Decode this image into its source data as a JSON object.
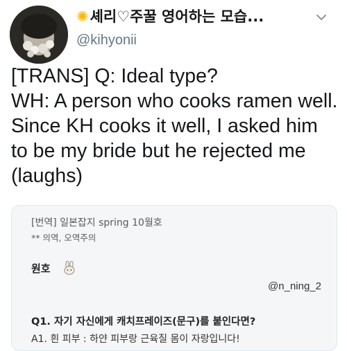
{
  "author": {
    "display_name_icon": "sun-flower-icon",
    "display_name": "셰리♡주꿀 영어하는 모습...",
    "handle": "@kihyonii",
    "avatar": "profile-photo"
  },
  "menu": {
    "icon": "chevron-down-icon"
  },
  "tweet": {
    "lines": [
      "[TRANS] Q: Ideal type?",
      "WH: A person who cooks ramen well. Since KH cooks it well, I asked him to be my bride but he rejected me (laughs)"
    ]
  },
  "quoted": {
    "header": "[번역] 일본잡지 spring 10월호",
    "note": "** 의역, 오역주의",
    "name": "원호",
    "name_icon": "bunny-icon",
    "credit": "@n_ning_2",
    "question": "Q1. 자기 자신에게 캐치프레이즈(문구)를 붙인다면?",
    "answer": "A1. 흰 피부 : 하얀 피부랑 근육질 몸이 자랑입니다!"
  },
  "colors": {
    "text": "#14171a",
    "secondary": "#657786",
    "accent_sun": "#f5b90f",
    "card_bg": "#f5f6f7",
    "card_border": "#e1e8ed"
  }
}
